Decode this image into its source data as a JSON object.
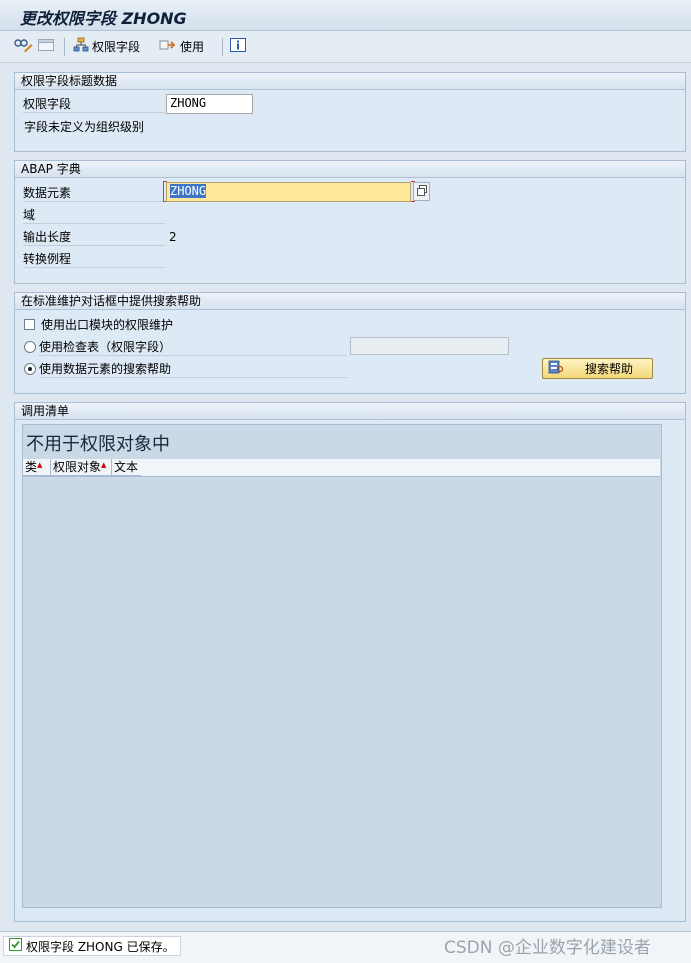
{
  "window": {
    "title": "更改权限字段 ZHONG"
  },
  "toolbar": {
    "auth_field_label": "权限字段",
    "use_label": "使用"
  },
  "group_header_data": {
    "title": "权限字段标题数据",
    "field_label": "权限字段",
    "field_value": "ZHONG",
    "note": "字段未定义为组织级别"
  },
  "group_abap": {
    "title": "ABAP 字典",
    "data_element_label": "数据元素",
    "data_element_value": "ZHONG",
    "domain_label": "域",
    "output_length_label": "输出长度",
    "output_length_value": "2",
    "conversion_label": "转换例程"
  },
  "group_search_help": {
    "title": "在标准维护对话框中提供搜索帮助",
    "checkbox_exit_label": "使用出口模块的权限维护",
    "radio_check_table_label": "使用检查表（权限字段）",
    "check_table_value": "",
    "radio_data_element_label": "使用数据元素的搜索帮助",
    "search_help_button": "搜索帮助"
  },
  "group_where_used": {
    "title": "调用清单",
    "table_title": "不用于权限对象中",
    "columns": [
      "类",
      "权限对象",
      "文本"
    ]
  },
  "status": {
    "message": "权限字段 ZHONG 已保存。"
  },
  "watermark": "CSDN @企业数字化建设者",
  "colors": {
    "background": "#dfe8f1",
    "selected_field": "#fde79a",
    "button": "#f3d77a",
    "ok": "#2f9a2f"
  }
}
